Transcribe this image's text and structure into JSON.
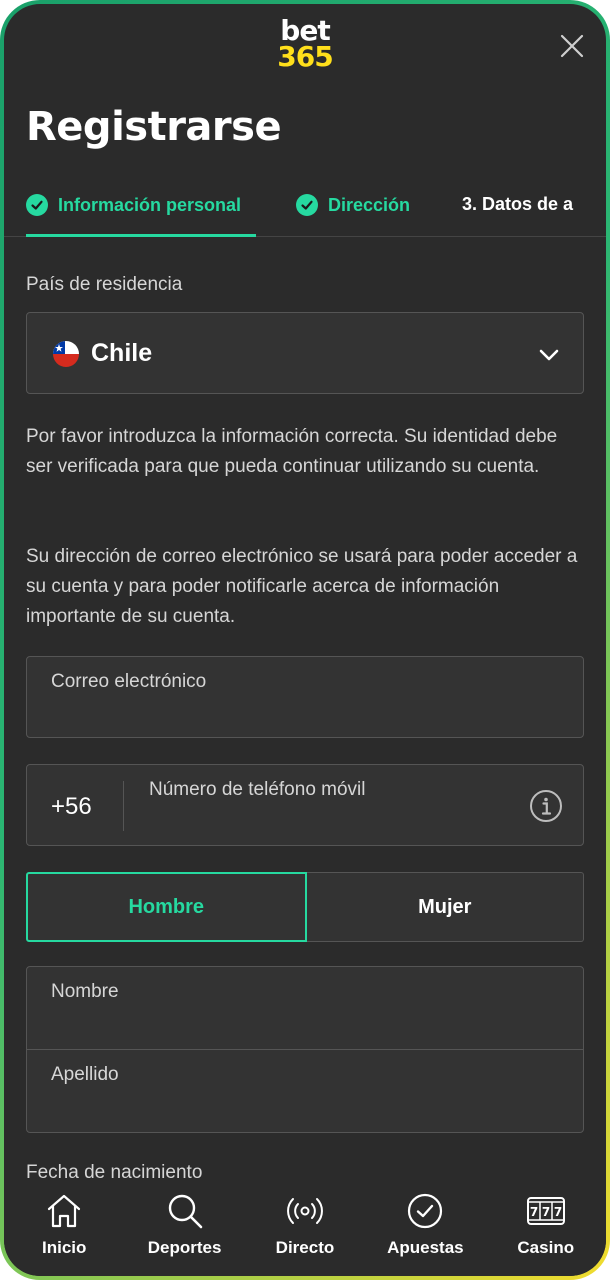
{
  "brand": {
    "logo_top": "bet",
    "logo_bottom": "365"
  },
  "header": {
    "title": "Registrarse"
  },
  "steps": [
    {
      "label": "Información personal",
      "status": "done"
    },
    {
      "label": "Dirección",
      "status": "done"
    },
    {
      "label": "3.  Datos de a",
      "status": "current"
    }
  ],
  "country": {
    "label": "País de residencia",
    "value": "Chile",
    "flag": "chile-flag-icon"
  },
  "info_paragraph_1": "Por favor introduzca la información correcta. Su identidad debe ser verificada para que pueda continuar utilizando su cuenta.",
  "info_paragraph_2": "Su dirección de correo electrónico se usará para poder acceder a su cuenta y para poder notificarle acerca de información importante de su cuenta.",
  "email": {
    "placeholder": "Correo electrónico",
    "value": ""
  },
  "phone": {
    "prefix": "+56",
    "placeholder": "Número de teléfono móvil",
    "value": ""
  },
  "gender": {
    "male": "Hombre",
    "female": "Mujer",
    "selected": "Hombre"
  },
  "first_name": {
    "placeholder": "Nombre",
    "value": ""
  },
  "last_name": {
    "placeholder": "Apellido",
    "value": ""
  },
  "birthdate": {
    "label": "Fecha de nacimiento"
  },
  "nav": [
    {
      "label": "Inicio",
      "icon": "home-icon"
    },
    {
      "label": "Deportes",
      "icon": "search-icon"
    },
    {
      "label": "Directo",
      "icon": "live-icon"
    },
    {
      "label": "Apuestas",
      "icon": "check-circle-icon"
    },
    {
      "label": "Casino",
      "icon": "slot-machine-icon"
    }
  ],
  "colors": {
    "accent": "#26d9a0",
    "background": "#2b2b2b",
    "logo_yellow": "#ffdf1b"
  }
}
